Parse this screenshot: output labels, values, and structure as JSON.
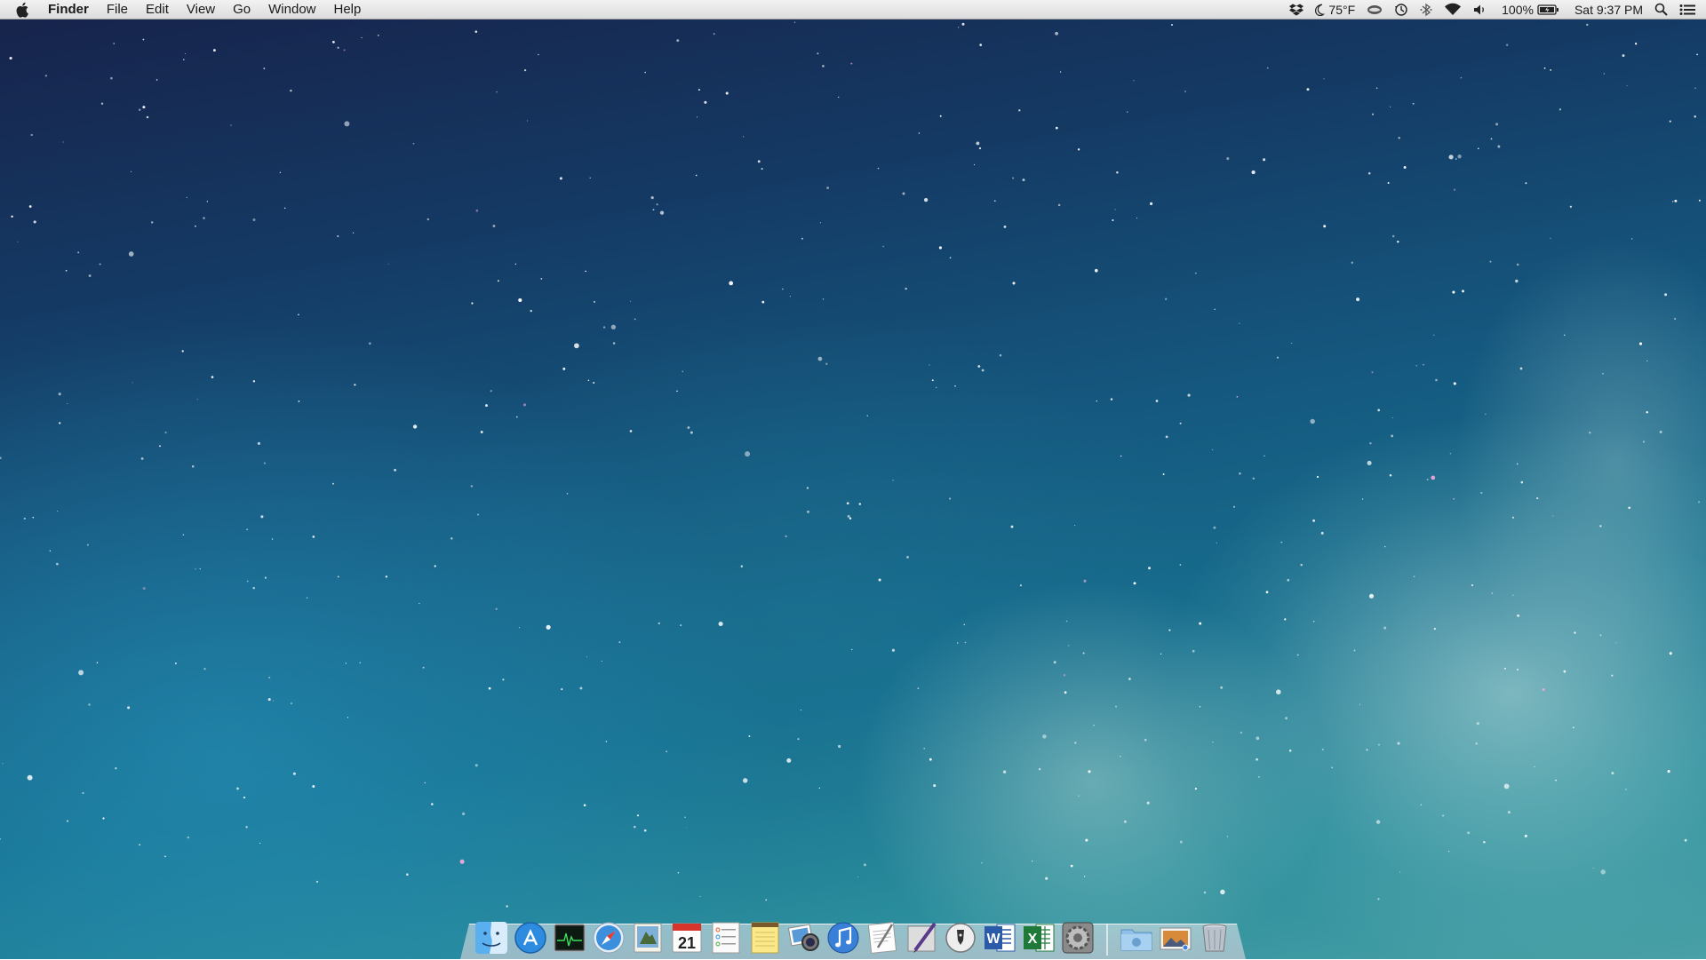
{
  "menubar": {
    "app_name": "Finder",
    "menus": [
      "File",
      "Edit",
      "View",
      "Go",
      "Window",
      "Help"
    ],
    "status": {
      "weather": "75°F",
      "battery": "100%",
      "clock": "Sat 9:37 PM"
    }
  },
  "dock": {
    "apps": [
      {
        "name": "Finder",
        "icon": "finder-icon"
      },
      {
        "name": "App Store",
        "icon": "app-store-icon"
      },
      {
        "name": "Activity Monitor",
        "icon": "activity-monitor-icon"
      },
      {
        "name": "Safari",
        "icon": "safari-icon"
      },
      {
        "name": "Preview",
        "icon": "preview-icon"
      },
      {
        "name": "Calendar",
        "icon": "calendar-icon",
        "label": "21"
      },
      {
        "name": "Reminders",
        "icon": "reminders-icon"
      },
      {
        "name": "Notes",
        "icon": "notes-icon"
      },
      {
        "name": "iPhoto",
        "icon": "iphoto-icon"
      },
      {
        "name": "iTunes",
        "icon": "itunes-icon"
      },
      {
        "name": "TextEdit",
        "icon": "textedit-icon"
      },
      {
        "name": "Script Editor",
        "icon": "script-editor-icon"
      },
      {
        "name": "Pen App",
        "icon": "pen-icon"
      },
      {
        "name": "Microsoft Word",
        "icon": "word-icon",
        "label": "W"
      },
      {
        "name": "Microsoft Excel",
        "icon": "excel-icon",
        "label": "X"
      },
      {
        "name": "System Preferences",
        "icon": "system-preferences-icon"
      }
    ],
    "others": [
      {
        "name": "Downloads",
        "icon": "downloads-folder-icon"
      },
      {
        "name": "Pictures",
        "icon": "pictures-stack-icon"
      },
      {
        "name": "Trash",
        "icon": "trash-icon"
      }
    ]
  },
  "colors": {
    "sky_top": "#17224a",
    "sky_bottom": "#4aa1a6",
    "menubar": "#e8e8e8"
  }
}
